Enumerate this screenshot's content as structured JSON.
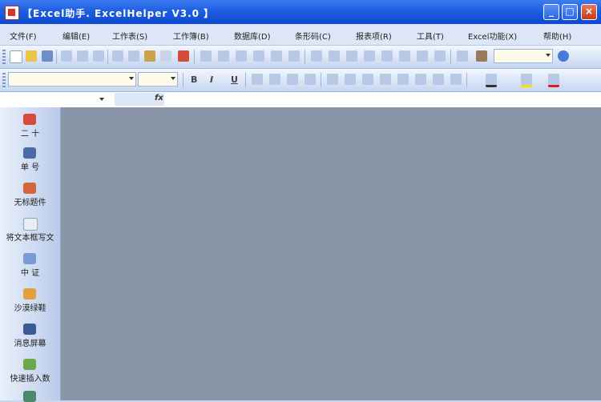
{
  "window": {
    "title": "【Excel助手. ExcelHelper V3.0 】",
    "minimize_symbol": "_",
    "maximize_symbol": "□",
    "close_symbol": "×",
    "icon": "excel-app-icon"
  },
  "menu": [
    "文件(F)",
    "编辑(E)",
    "工作表(S)",
    "工作簿(B)",
    "数据库(D)",
    "条形码(C)",
    "报表项(R)",
    "工具(T)",
    "Excel功能(X)",
    "帮助(H)"
  ],
  "toolbar": {
    "font_name": "",
    "font_size": "",
    "bold": "B",
    "italic": "I",
    "underline": "U",
    "zoom_value": ""
  },
  "formula": {
    "name_box": "",
    "fx": "fx"
  },
  "sidebar": {
    "items": [
      "二 十",
      "单 号",
      "无标题件",
      "将文本框写文",
      "中 证",
      "沙漠绿鞋",
      "消息屏幕",
      "快速插入数"
    ]
  },
  "colors": {
    "titlebar": "#1f5ee0",
    "workspace": "#8a95a8",
    "toolbar": "#c6d6f1"
  }
}
